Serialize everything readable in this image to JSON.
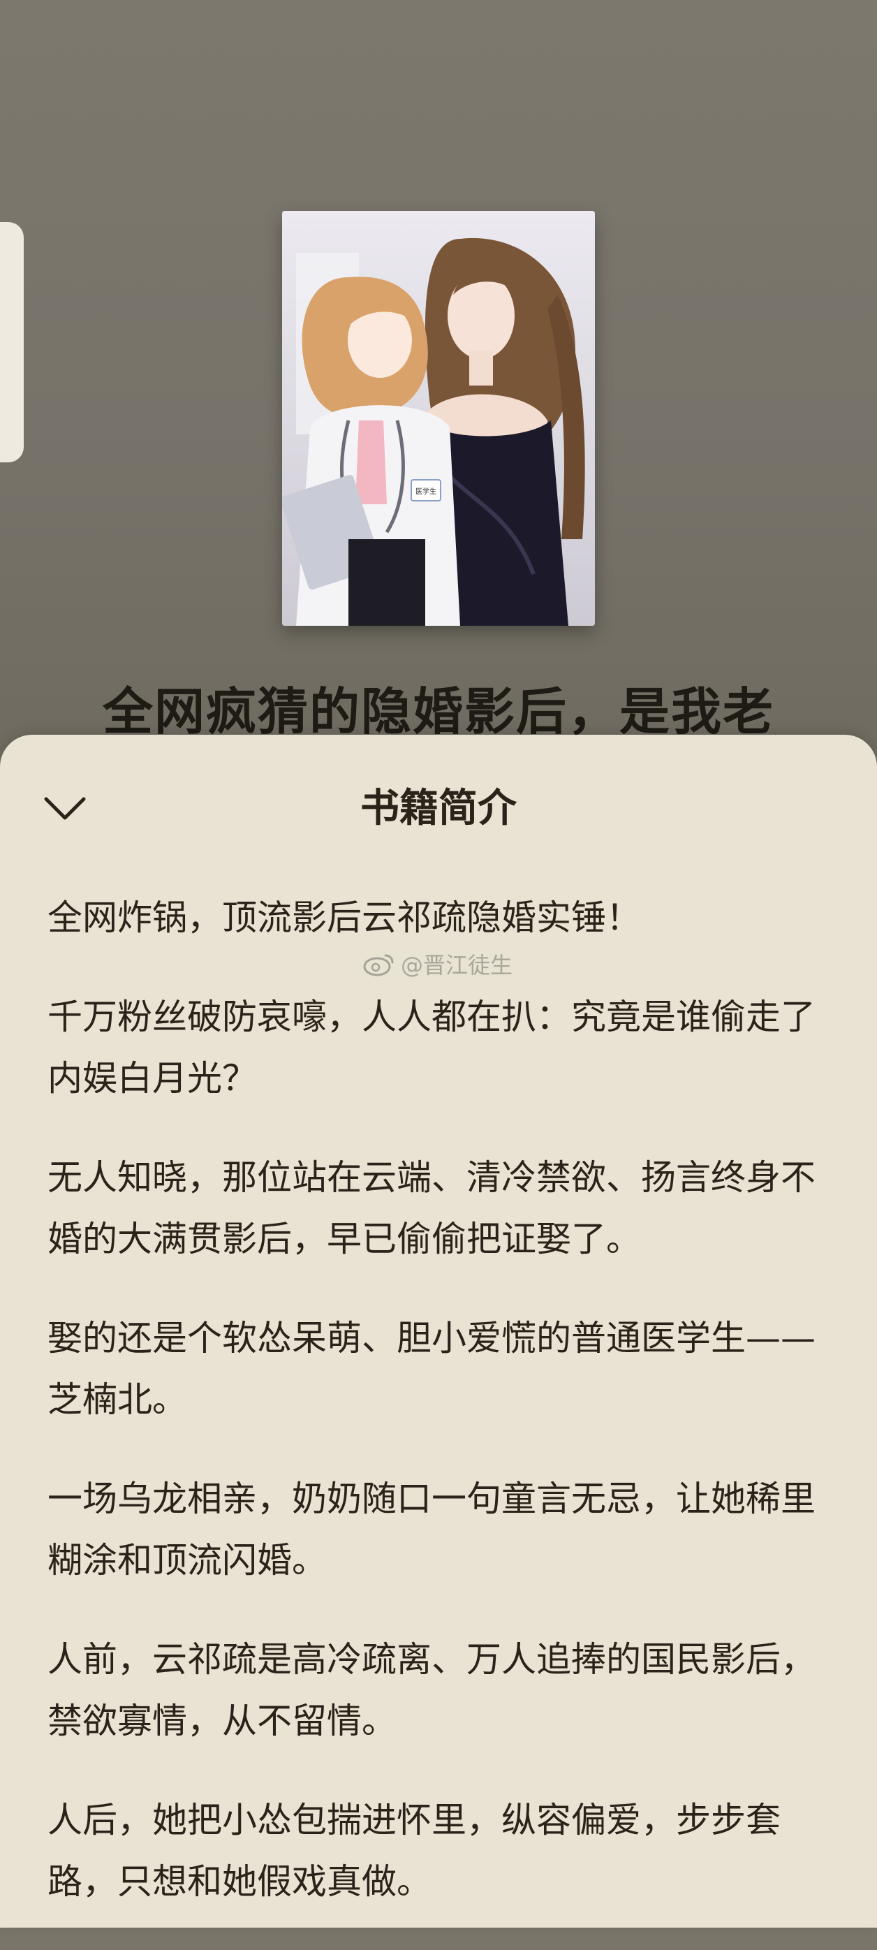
{
  "book": {
    "title": "全网疯猜的隐婚影后，是我老"
  },
  "sheet": {
    "title": "书籍简介",
    "paragraphs": [
      "全网炸锅，顶流影后云祁疏隐婚实锤！",
      "千万粉丝破防哀嚎，人人都在扒：究竟是谁偷走了内娱白月光？",
      "无人知晓，那位站在云端、清冷禁欲、扬言终身不婚的大满贯影后，早已偷偷把证娶了。",
      "娶的还是个软怂呆萌、胆小爱慌的普通医学生——芝楠北。",
      "一场乌龙相亲，奶奶随口一句童言无忌，让她稀里糊涂和顶流闪婚。",
      "人前，云祁疏是高冷疏离、万人追捧的国民影后，禁欲寡情，从不留情。",
      "人后，她把小怂包揣进怀里，纵容偏爱，步步套路，只想和她假戏真做。"
    ]
  },
  "watermark": {
    "text": "@晋江徒生",
    "icon": "weibo-icon"
  },
  "cover": {
    "badge_text": "医学生"
  },
  "icons": {
    "collapse": "chevron-down-icon"
  },
  "colors": {
    "background": "#7a7569",
    "sheet": "#e8e3d2",
    "text": "#2a231a"
  }
}
